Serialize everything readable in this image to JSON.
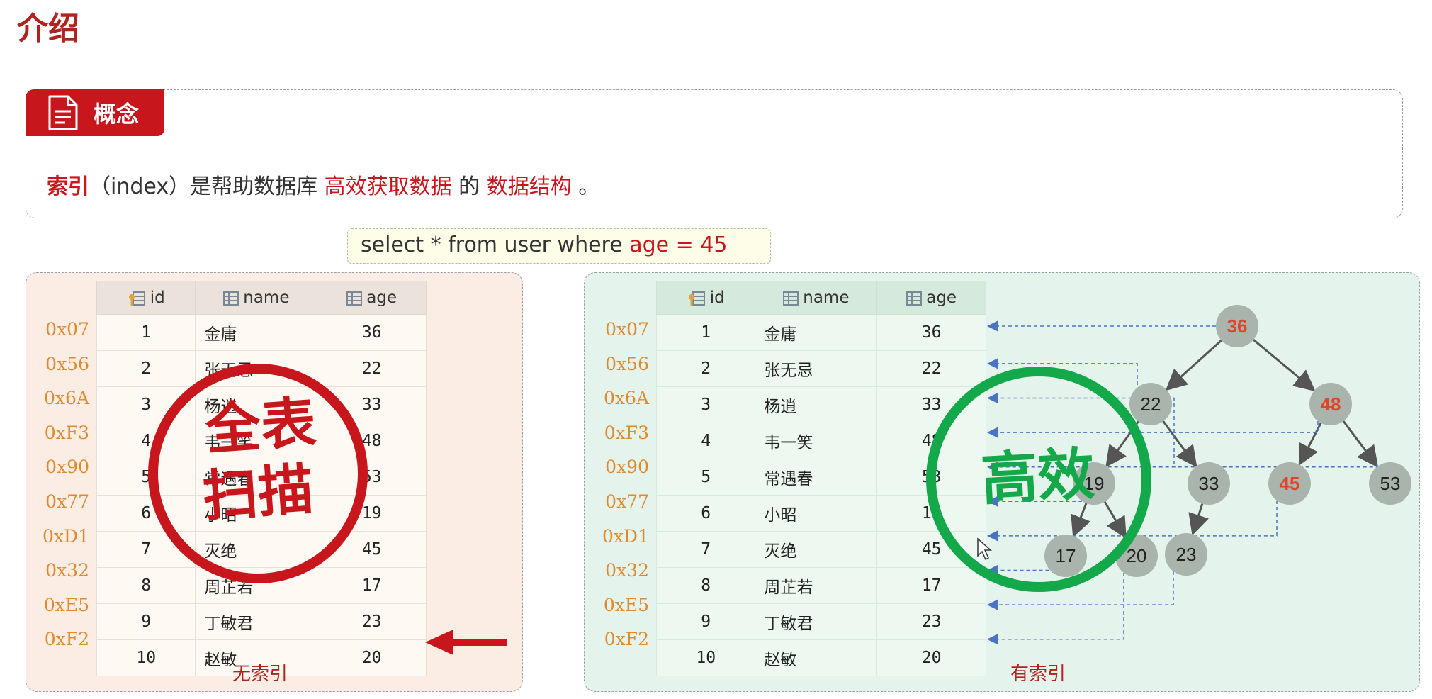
{
  "title": "介绍",
  "concept": {
    "label": "概念",
    "definition": {
      "term": "索引",
      "paren": "（index）",
      "text1": "是帮助数据库",
      "highlight1": "高效获取数据",
      "text2": "的",
      "highlight2": "数据结构",
      "end": "。"
    }
  },
  "sql": {
    "prefix": "select * from user where ",
    "condition": "age = 45"
  },
  "table": {
    "columns": [
      "id",
      "name",
      "age"
    ],
    "rows": [
      {
        "addr": "0x07",
        "id": "1",
        "name": "金庸",
        "age": "36"
      },
      {
        "addr": "0x56",
        "id": "2",
        "name": "张无忌",
        "age": "22"
      },
      {
        "addr": "0x6A",
        "id": "3",
        "name": "杨逍",
        "age": "33"
      },
      {
        "addr": "0xF3",
        "id": "4",
        "name": "韦一笑",
        "age": "48"
      },
      {
        "addr": "0x90",
        "id": "5",
        "name": "常遇春",
        "age": "53"
      },
      {
        "addr": "0x77",
        "id": "6",
        "name": "小昭",
        "age": "19"
      },
      {
        "addr": "0xD1",
        "id": "7",
        "name": "灭绝",
        "age": "45"
      },
      {
        "addr": "0x32",
        "id": "8",
        "name": "周芷若",
        "age": "17"
      },
      {
        "addr": "0xE5",
        "id": "9",
        "name": "丁敏君",
        "age": "23"
      },
      {
        "addr": "0xF2",
        "id": "10",
        "name": "赵敏",
        "age": "20"
      }
    ]
  },
  "left_panel": {
    "caption": "无索引",
    "stamp": [
      "全表",
      "扫描"
    ],
    "stamp_color": "#c8161d"
  },
  "right_panel": {
    "caption": "有索引",
    "stamp": "高效",
    "stamp_color": "#13a94a"
  },
  "tree": {
    "nodes": [
      {
        "key": "n36",
        "label": "36",
        "highlight": true
      },
      {
        "key": "n22",
        "label": "22",
        "highlight": false
      },
      {
        "key": "n48",
        "label": "48",
        "highlight": true
      },
      {
        "key": "n19",
        "label": "19",
        "highlight": false
      },
      {
        "key": "n33",
        "label": "33",
        "highlight": false
      },
      {
        "key": "n45",
        "label": "45",
        "highlight": true
      },
      {
        "key": "n53",
        "label": "53",
        "highlight": false
      },
      {
        "key": "n17",
        "label": "17",
        "highlight": false
      },
      {
        "key": "n20",
        "label": "20",
        "highlight": false
      },
      {
        "key": "n23",
        "label": "23",
        "highlight": false
      }
    ],
    "edges": [
      [
        "n36",
        "n22"
      ],
      [
        "n36",
        "n48"
      ],
      [
        "n22",
        "n19"
      ],
      [
        "n22",
        "n33"
      ],
      [
        "n48",
        "n45"
      ],
      [
        "n48",
        "n53"
      ],
      [
        "n19",
        "n17"
      ],
      [
        "n19",
        "n20"
      ],
      [
        "n33",
        "n23"
      ]
    ],
    "node_color": "#a9b5ac",
    "highlight_text_color": "#e0452a"
  },
  "colors": {
    "accent": "#c8161d",
    "address": "#e08a2e",
    "pointer": "#4a73c4"
  }
}
